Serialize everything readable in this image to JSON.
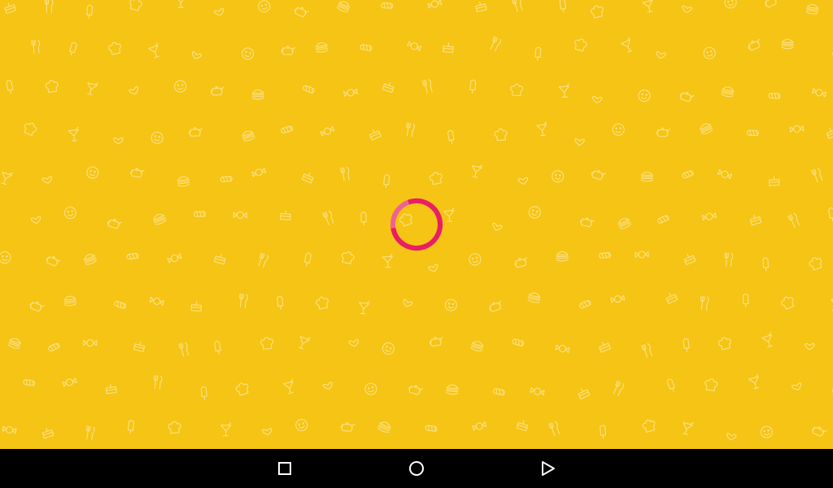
{
  "screen": {
    "background_color": "#f5c414",
    "pattern_stroke_color": "#fde69b",
    "pattern_icons": [
      "cake-icon",
      "fork-knife-icon",
      "popsicle-icon",
      "chef-hat-icon",
      "cocktail-icon",
      "heart-icon",
      "smiley-icon",
      "teapot-icon",
      "burger-icon",
      "bread-icon",
      "candy-icon"
    ]
  },
  "loading_indicator": {
    "progress": 0.78,
    "color_primary": "#e91e63",
    "color_track": "#f06292"
  },
  "navigation_bar": {
    "background_color": "#000000",
    "buttons": [
      {
        "name": "recents",
        "icon": "square-icon"
      },
      {
        "name": "home",
        "icon": "circle-icon"
      },
      {
        "name": "back",
        "icon": "triangle-icon"
      }
    ]
  }
}
